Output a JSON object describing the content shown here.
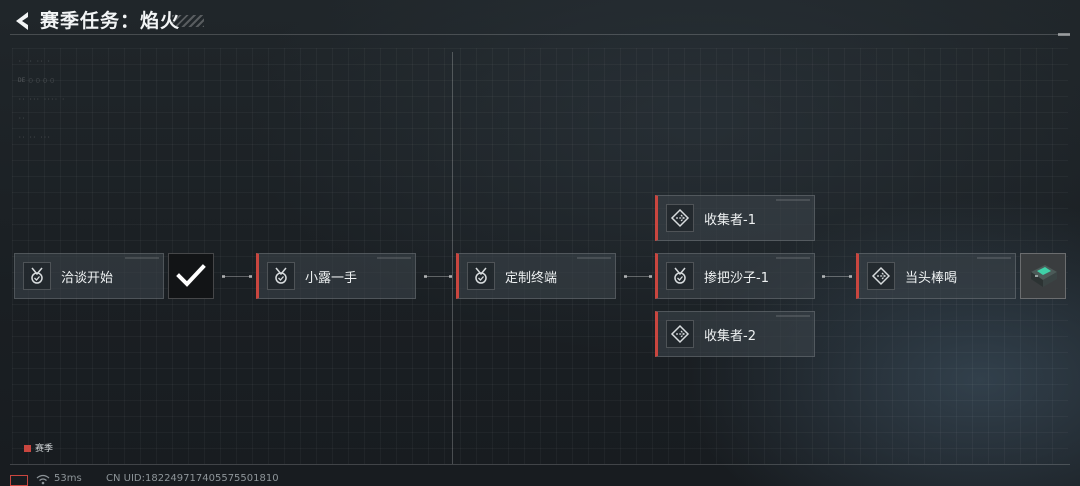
{
  "header": {
    "title": "赛季任务：焰火"
  },
  "nodes": [
    {
      "id": "n1",
      "label": "洽谈开始",
      "icon": "medal-icon",
      "status": "completed"
    },
    {
      "id": "n2",
      "label": "小露一手",
      "icon": "medal-icon"
    },
    {
      "id": "n3",
      "label": "定制终端",
      "icon": "medal-icon"
    },
    {
      "id": "n4",
      "label": "收集者-1",
      "icon": "diamond-arrow-icon"
    },
    {
      "id": "n5",
      "label": "掺把沙子-1",
      "icon": "medal-icon"
    },
    {
      "id": "n6",
      "label": "收集者-2",
      "icon": "diamond-arrow-icon"
    },
    {
      "id": "n7",
      "label": "当头棒喝",
      "icon": "diamond-arrow-icon",
      "reward": "device-reward-icon"
    }
  ],
  "legend": {
    "label": "赛季",
    "color": "#c9463f"
  },
  "status_bar": {
    "ping": "53ms",
    "uid": "CN UID:182249717405575501810"
  },
  "colors": {
    "accent": "#c9463f",
    "background": "#1b2024",
    "node_fill": "#3a4248"
  }
}
